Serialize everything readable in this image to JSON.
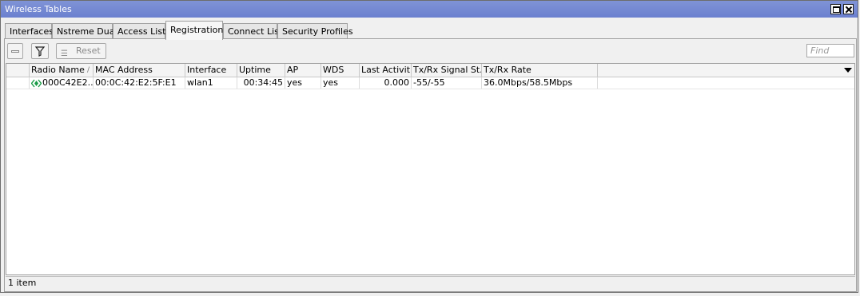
{
  "window": {
    "title": "Wireless Tables"
  },
  "tabs": [
    {
      "label": "Interfaces"
    },
    {
      "label": "Nstreme Dual"
    },
    {
      "label": "Access List"
    },
    {
      "label": "Registration"
    },
    {
      "label": "Connect List"
    },
    {
      "label": "Security Profiles"
    }
  ],
  "active_tab": "Registration",
  "toolbar": {
    "reset_label": "Reset",
    "find_placeholder": "Find"
  },
  "table": {
    "columns": [
      "Radio Name",
      "MAC Address",
      "Interface",
      "Uptime",
      "AP",
      "WDS",
      "Last Activit...",
      "Tx/Rx Signal St...",
      "Tx/Rx Rate"
    ],
    "sort_column": "Radio Name",
    "sort_marker": "/",
    "rows": [
      {
        "radio_name": "000C42E2...",
        "mac_address": "00:0C:42:E2:5F:E1",
        "interface": "wlan1",
        "uptime": "00:34:45",
        "ap": "yes",
        "wds": "yes",
        "last_activity": "0.000",
        "signal": "-55/-55",
        "rate": "36.0Mbps/58.5Mbps"
      }
    ]
  },
  "status": {
    "count_text": "1 item"
  },
  "icons": {
    "row_icon": "radio-icon",
    "filter": "filter-icon",
    "remove": "minus-icon",
    "reset": "reset-icon"
  },
  "colors": {
    "titlebar": "#7489d3",
    "row_icon": "#1a9b47"
  }
}
